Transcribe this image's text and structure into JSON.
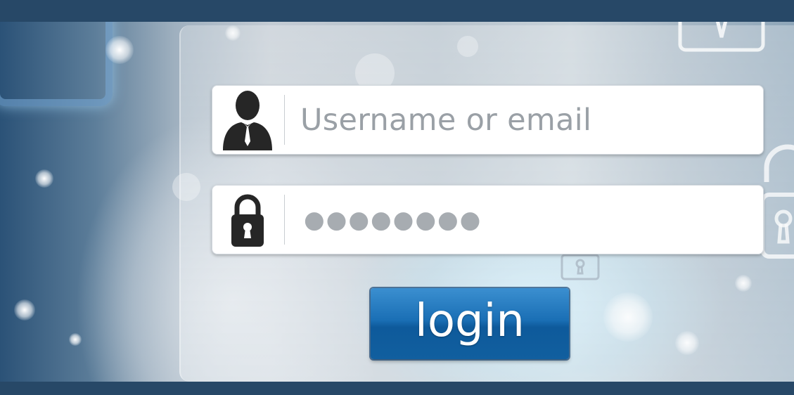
{
  "login_form": {
    "username_placeholder": "Username or email",
    "password_mask": "●●●●●●●●",
    "login_label": "login"
  },
  "icons": {
    "username": "user-icon",
    "password": "padlock-icon"
  },
  "colors": {
    "frame": "#274867",
    "button": "#1a6fb5",
    "placeholder": "#9aa0a6"
  }
}
